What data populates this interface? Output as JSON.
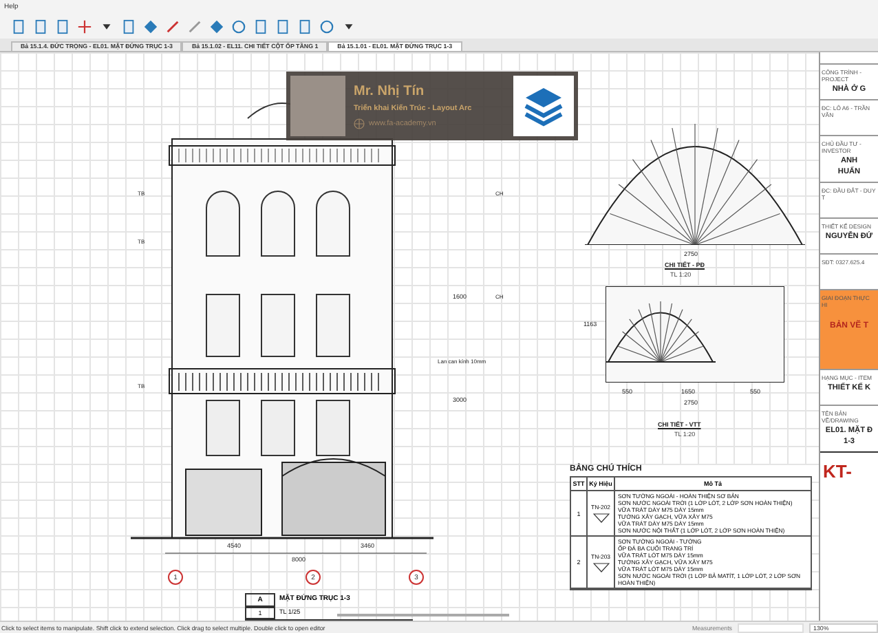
{
  "menu": [
    "Help"
  ],
  "tabs": [
    {
      "label": "Bả 15.1.4. ĐỨC TRỌNG - EL01. MẶT ĐỨNG TRỤC 1-3",
      "selected": false
    },
    {
      "label": "Bả 15.1.02 - EL11. CHI TIẾT CỘT ỐP TẦNG 1",
      "selected": false
    },
    {
      "label": "Bả 15.1.01 - EL01. MẶT ĐỨNG TRỤC 1-3",
      "selected": true
    }
  ],
  "elevation": {
    "tags": [
      "TB",
      "TB",
      "TB",
      "CH",
      "CH"
    ],
    "note": "Lan can kính 10mm",
    "dims_horizontal": [
      "4540",
      "3460"
    ],
    "dim_total": "8000",
    "dims_vertical": [
      "1600",
      "3000"
    ],
    "axes": [
      "1",
      "2",
      "3"
    ]
  },
  "details": [
    {
      "title": "CHI TIẾT - PĐ",
      "scale": "TL 1:20",
      "dims": [
        "2750"
      ]
    },
    {
      "title": "CHI TIẾT - VTT",
      "scale": "TL 1:20",
      "dims": [
        "550",
        "1650",
        "550",
        "2750"
      ],
      "side": "1163"
    }
  ],
  "view_label": {
    "letter": "A",
    "title": "MẶT ĐỨNG TRỤC 1-3",
    "number": "1",
    "scale": "TL 1/25"
  },
  "legend": {
    "title": "BẢNG CHÚ THÍCH",
    "columns": [
      "STT",
      "Ký Hiệu",
      "Mô Tả"
    ],
    "rows": [
      {
        "stt": "1",
        "symbol": "TN-202",
        "lines": [
          "SƠN TƯỜNG NGOÀI - HOÀN THIỆN SƠ BẢN",
          "SƠN NƯỚC NGOÀI TRỜI (1 LỚP LÓT, 2 LỚP SƠN HOÀN THIỆN)",
          "VỮA TRÁT DÀY M75 DÀY 15mm",
          "TƯỜNG XÂY GẠCH, VỮA XÂY M75",
          "VỮA TRÁT DÀY M75 DÀY 15mm",
          "SƠN NƯỚC NỘI THẤT (1 LỚP LÓT, 2 LỚP SƠN HOÀN THIỆN)"
        ]
      },
      {
        "stt": "2",
        "symbol": "TN-203",
        "lines": [
          "SƠN TƯỜNG NGOÀI - TƯỜNG",
          "ỐP ĐÁ BA CUỐI TRANG TRÍ",
          "VỮA TRÁT LÓT M75 DÀY 15mm",
          "TƯỜNG XÂY GẠCH, VỮA XÂY M75",
          "VỮA TRÁT LÓT M75 DÀY 15mm",
          "SƠN NƯỚC NGOÀI TRỜI (1 LỚP BẢ MATÍT, 1 LỚP LÓT, 2 LỚP SƠN HOÀN THIỆN)"
        ]
      }
    ]
  },
  "title_block": [
    {
      "label": "CÔNG TRÌNH - PROJECT",
      "values": [
        "NHÀ Ở G"
      ],
      "highlight": false
    },
    {
      "label": "ĐC: LÔ A6 - TRẦN VĂN",
      "highlight": false
    },
    {
      "label": "CHỦ ĐẦU TƯ - INVESTOR",
      "values": [
        "ANH",
        "HUẤN"
      ],
      "highlight": false
    },
    {
      "label": "ĐC: ĐẦU ĐẮT - DUY T",
      "highlight": false
    },
    {
      "label": "THIẾT KẾ DESIGN",
      "values": [
        "NGUYỄN ĐỨ"
      ],
      "highlight": false
    },
    {
      "label": "SĐT: 0327.625.4",
      "highlight": false
    },
    {
      "label": "GIAI ĐOẠN THỰC HI",
      "values": [
        "BẢN VẼ T"
      ],
      "highlight": true
    },
    {
      "label": "HẠNG MỤC - ITEM",
      "values": [
        "THIẾT KẾ K"
      ],
      "highlight": false
    },
    {
      "label": "TÊN BẢN VẼ/DRAWING",
      "values": [
        "EL01. MẶT Đ",
        "1-3"
      ],
      "highlight": false
    }
  ],
  "sheet_code": "KT-",
  "overlay": {
    "name": "Mr. Nhị Tín",
    "subtitle": "Triển khai Kiến Trúc - Layout Arc",
    "website": "www.fa-academy.vn"
  },
  "status_bar": {
    "hint": "Click to select items to manipulate. Shift click to extend selection. Click drag to select multiple. Double click to open editor",
    "measurements": "Measurements",
    "zoom": "130%"
  }
}
